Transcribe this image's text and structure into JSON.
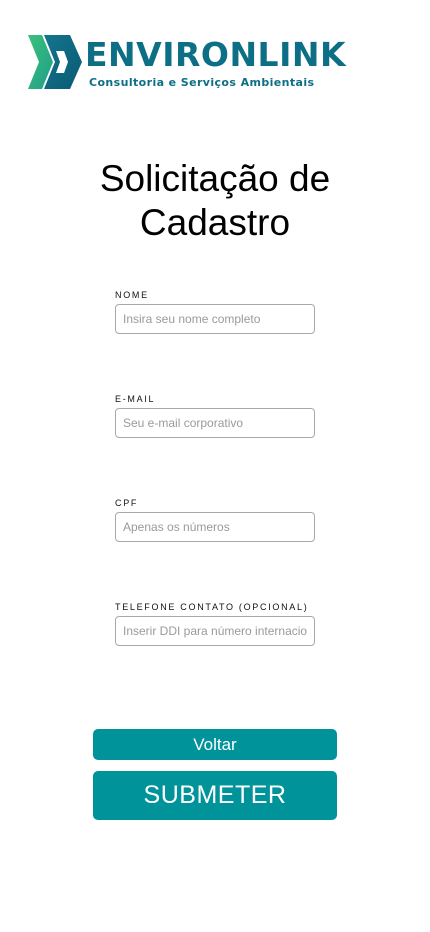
{
  "logo": {
    "name": "ENVIRONLINK",
    "tagline": "Consultoria e Serviços Ambientais"
  },
  "title": {
    "line1": "Solicitação de",
    "line2": "Cadastro"
  },
  "form": {
    "nome": {
      "label": "NOME",
      "placeholder": "Insira seu nome completo",
      "value": ""
    },
    "email": {
      "label": "E-MAIL",
      "placeholder": "Seu e-mail corporativo",
      "value": ""
    },
    "cpf": {
      "label": "CPF",
      "placeholder": "Apenas os números",
      "value": ""
    },
    "telefone": {
      "label": "TELEFONE CONTATO (OPCIONAL)",
      "placeholder": "Inserir DDI para número internacional",
      "value": ""
    }
  },
  "buttons": {
    "back_label": "Voltar",
    "submit_label": "SUBMETER"
  },
  "colors": {
    "brand": "#0c6f85",
    "brand_light": "#2bb673",
    "button": "#00939a",
    "button_text": "#ffffff"
  },
  "icons": {
    "logo_mark": "environlink-logo-mark"
  }
}
